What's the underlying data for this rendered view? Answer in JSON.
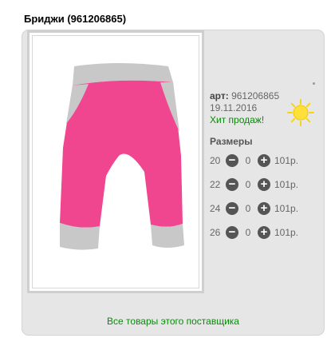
{
  "product": {
    "title": "Бриджи (961206865)",
    "art_label": "арт:",
    "art_value": "961206865",
    "date": "19.11.2016",
    "badge": "Хит продаж!"
  },
  "sizes": {
    "title": "Размеры",
    "rows": [
      {
        "size": "20",
        "qty": "0",
        "price": "101р."
      },
      {
        "size": "22",
        "qty": "0",
        "price": "101р."
      },
      {
        "size": "24",
        "qty": "0",
        "price": "101р."
      },
      {
        "size": "26",
        "qty": "0",
        "price": "101р."
      }
    ]
  },
  "supplier_link": "Все товары этого поставщика",
  "colors": {
    "pants_pink": "#f0458f",
    "pants_grey": "#c8c8c8",
    "link_green": "#0a8a0a",
    "sun_yellow": "#f5d60a"
  },
  "icons": {
    "minus": "minus-circle-icon",
    "plus": "plus-circle-icon",
    "sun": "sun-icon"
  }
}
